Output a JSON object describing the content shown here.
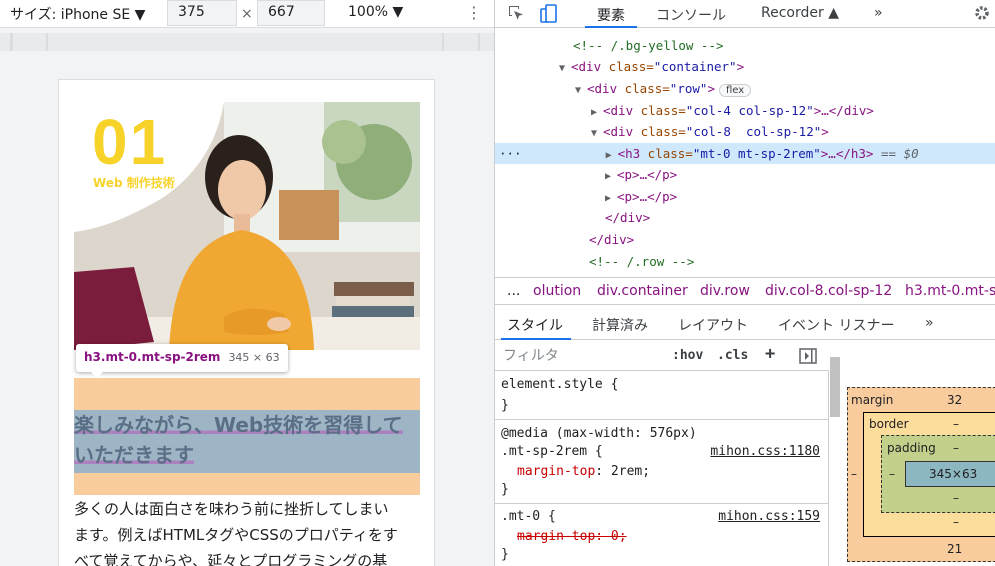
{
  "device_toolbar": {
    "device": "サイズ: iPhone SE ▼",
    "width": "375",
    "times": "×",
    "height": "667",
    "zoom": "100% ▼",
    "more_icon": "kebab-menu-icon"
  },
  "page": {
    "hero_number": "01",
    "hero_subtitle": "Web 制作技術",
    "tooltip_selector": "h3.mt-0.mt-sp-2rem",
    "tooltip_size": "345 × 63",
    "heading_line1": "楽しみながら、Web技術を習得して",
    "heading_line2": "いただきます",
    "body_line1": "多くの人は面白さを味わう前に挫折してしまい",
    "body_line2": "ます。例えばHTMLタグやCSSのプロパティをす",
    "body_line3": "べて覚えてからや、延々とプログラミングの基"
  },
  "devtools": {
    "tabs": [
      "要素",
      "コンソール",
      "Recorder ▲",
      "»"
    ],
    "active_tab": "要素",
    "dom": {
      "l0": "<!-- /.bg-yellow -->",
      "l1_tag": "<div",
      "l1_attr": " class=",
      "l1_val": "\"container\"",
      "l1_end": ">",
      "l2_tag": "<div",
      "l2_attr": " class=",
      "l2_val": "\"row\"",
      "l2_end": ">",
      "l2_badge": "flex",
      "l3_tag": "<div",
      "l3_attr": " class=",
      "l3_val": "\"col-4 col-sp-12\"",
      "l3_end": ">…</div>",
      "l4_tag": "<div",
      "l4_attr": " class=",
      "l4_val": "\"col-8  col-sp-12\"",
      "l4_end": ">",
      "l5_dots": "···",
      "l5_tag": "<h3",
      "l5_attr": " class=",
      "l5_val": "\"mt-0 mt-sp-2rem\"",
      "l5_end": ">…</h3>",
      "l5_eq": " == $0",
      "l6": "<p>…</p>",
      "l7": "<p>…</p>",
      "l8": "</div>",
      "l9": "</div>",
      "l10": "<!-- /.row -->"
    },
    "breadcrumbs": {
      "more": "...",
      "items": [
        "olution",
        "div.container",
        "div.row",
        "div.col-8.col-sp-12",
        "h3.mt-0.mt-sp"
      ]
    },
    "style_tabs": [
      "スタイル",
      "計算済み",
      "レイアウト",
      "イベント リスナー",
      "»"
    ],
    "filter_placeholder": "フィルタ",
    "filter_hov": ":hov",
    "filter_cls": ".cls",
    "filter_plus": "+",
    "rules": {
      "r1_selector": "element.style {",
      "r1_close": "}",
      "r2_media": "@media (max-width: 576px)",
      "r2_selector": ".mt-sp-2rem {",
      "r2_source": "mihon.css:1180",
      "r2_prop": "margin-top",
      "r2_val": ": 2rem;",
      "r2_close": "}",
      "r3_selector": ".mt-0 {",
      "r3_source": "mihon.css:159",
      "r3_prop": "margin-top: 0;",
      "r3_close": "}"
    },
    "box_model": {
      "margin_label": "margin",
      "margin_top": "32",
      "margin_left": "–",
      "margin_bottom": "21",
      "border_label": "border",
      "border_top": "–",
      "border_bottom": "–",
      "padding_label": "padding",
      "padding_top": "–",
      "padding_left": "–",
      "padding_bottom": "–",
      "content": "345×63"
    }
  },
  "colors": {
    "accent": "#1a73e8",
    "tag": "#881280",
    "attr": "#994500",
    "value": "#1a1aa6",
    "comment": "#236e25",
    "highlight_margin": "#f6b26b",
    "highlight_content": "#6fa8dc",
    "hero_yellow": "#f7d32a"
  }
}
